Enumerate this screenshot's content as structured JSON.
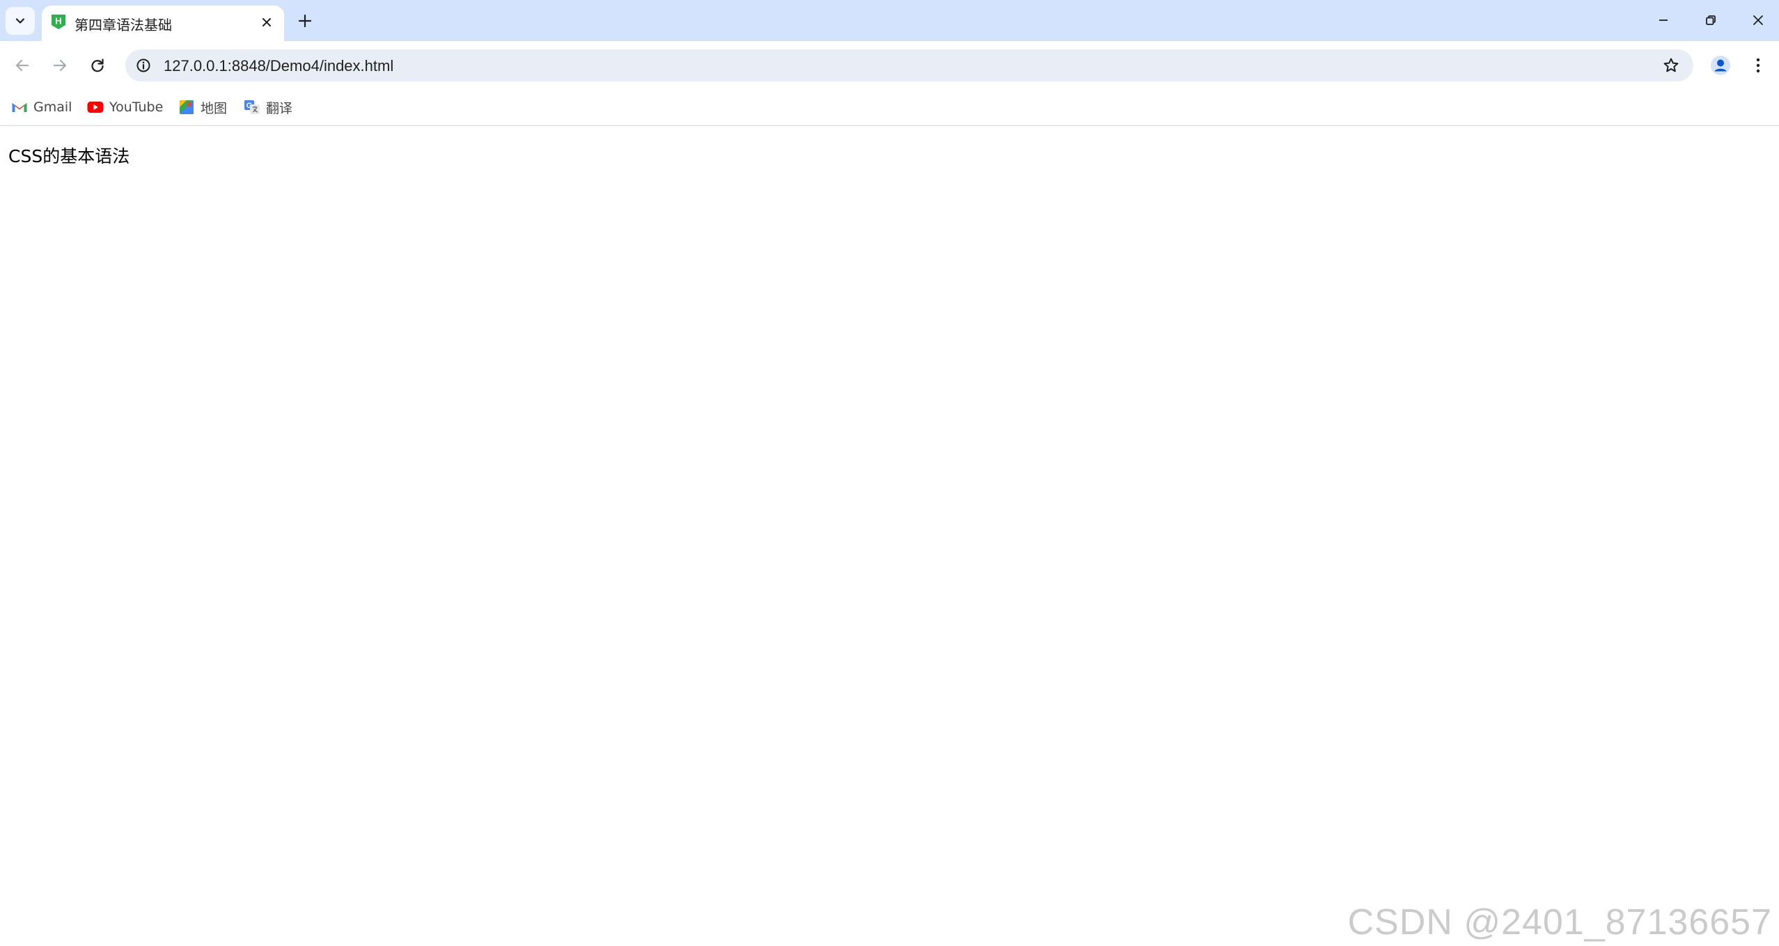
{
  "tab": {
    "title": "第四章语法基础",
    "favicon_letter": "H"
  },
  "toolbar": {
    "url": "127.0.0.1:8848/Demo4/index.html"
  },
  "bookmarks": [
    {
      "label": "Gmail",
      "icon": "gmail-icon"
    },
    {
      "label": "YouTube",
      "icon": "youtube-icon"
    },
    {
      "label": "地图",
      "icon": "maps-icon"
    },
    {
      "label": "翻译",
      "icon": "translate-icon"
    }
  ],
  "page": {
    "text": "CSS的基本语法"
  },
  "watermark": {
    "text": "CSDN @2401_87136657"
  },
  "colors": {
    "tabstrip": "#d3e3fd",
    "omnibox": "#e9eef6",
    "accent": "#0b57d0"
  }
}
